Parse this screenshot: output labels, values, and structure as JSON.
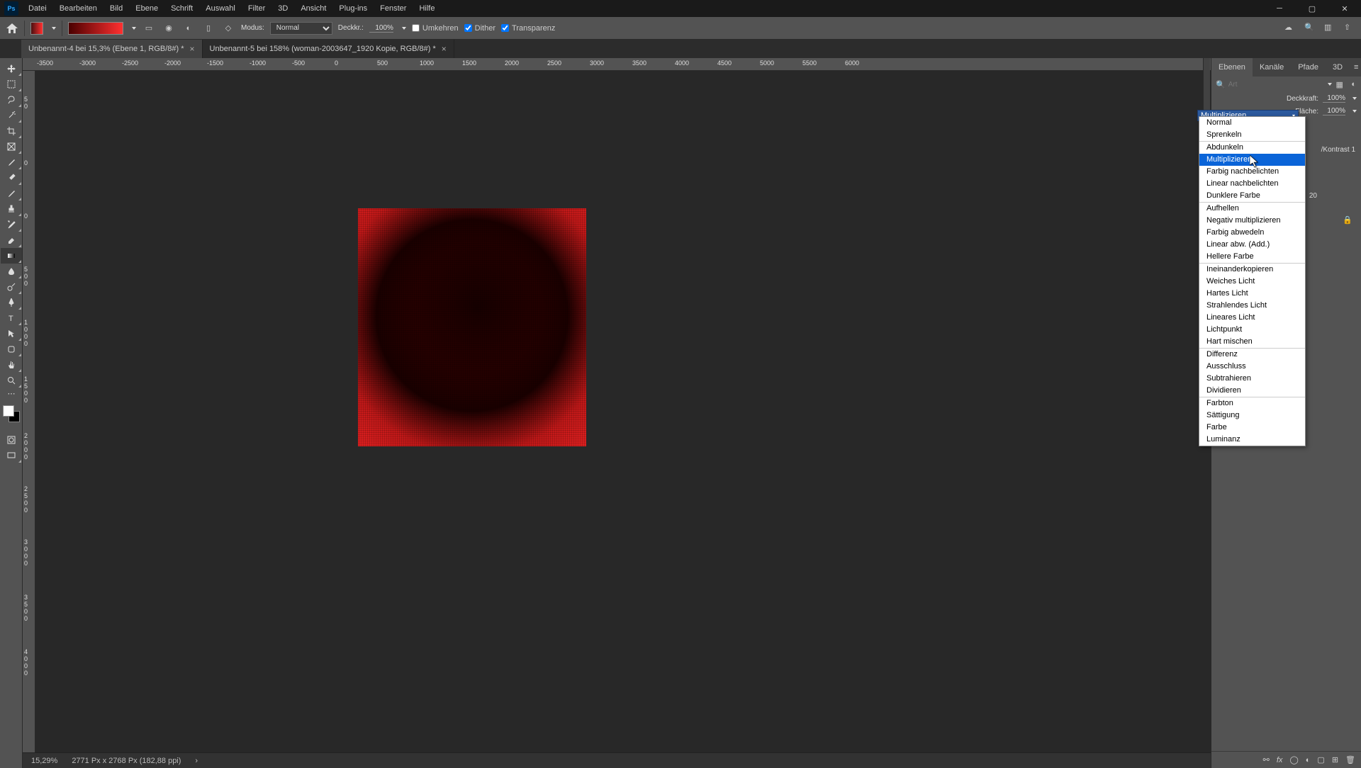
{
  "menu": [
    "Datei",
    "Bearbeiten",
    "Bild",
    "Ebene",
    "Schrift",
    "Auswahl",
    "Filter",
    "3D",
    "Ansicht",
    "Plug-ins",
    "Fenster",
    "Hilfe"
  ],
  "options": {
    "modus_label": "Modus:",
    "modus_value": "Normal",
    "deckkraft_label": "Deckkr.:",
    "deckkraft_value": "100%",
    "umkehren": "Umkehren",
    "dither": "Dither",
    "transparenz": "Transparenz"
  },
  "tabs": [
    "Unbenannt-4 bei 15,3% (Ebene 1, RGB/8#) *",
    "Unbenannt-5 bei 158% (woman-2003647_1920 Kopie, RGB/8#) *"
  ],
  "ruler_h": [
    "-3500",
    "-3000",
    "-2500",
    "-2000",
    "-1500",
    "-1000",
    "-500",
    "0",
    "500",
    "1000",
    "1500",
    "2000",
    "2500",
    "3000",
    "3500",
    "4000",
    "4500",
    "5000",
    "5500",
    "6000"
  ],
  "ruler_v": [
    "5\n0",
    "0",
    "5\n0\n0",
    "1\n0\n0",
    "0",
    "1\n5\n0",
    "0",
    "2\n0\n0",
    "2\n5\n0",
    "0",
    "3\n0\n0",
    "0",
    "3\n5\n0",
    "0",
    "4\n0\n0"
  ],
  "status": {
    "zoom": "15,29%",
    "info": "2771 Px x 2768 Px (182,88 ppi)"
  },
  "panel": {
    "tabs": [
      "Ebenen",
      "Kanäle",
      "Pfade",
      "3D"
    ],
    "filter_placeholder": "Art",
    "blend_selected": "Multiplizieren",
    "deckkraft_label": "Deckkraft:",
    "deckkraft_value": "100%",
    "flaeche_label": "Fläche:",
    "flaeche_value": "100%",
    "kontrast_label": "/Kontrast 1",
    "hidden_value": "20"
  },
  "blend_groups": [
    [
      "Normal",
      "Sprenkeln"
    ],
    [
      "Abdunkeln",
      "Multiplizieren",
      "Farbig nachbelichten",
      "Linear nachbelichten",
      "Dunklere Farbe"
    ],
    [
      "Aufhellen",
      "Negativ multiplizieren",
      "Farbig abwedeln",
      "Linear abw. (Add.)",
      "Hellere Farbe"
    ],
    [
      "Ineinanderkopieren",
      "Weiches Licht",
      "Hartes Licht",
      "Strahlendes Licht",
      "Lineares Licht",
      "Lichtpunkt",
      "Hart mischen"
    ],
    [
      "Differenz",
      "Ausschluss",
      "Subtrahieren",
      "Dividieren"
    ],
    [
      "Farbton",
      "Sättigung",
      "Farbe",
      "Luminanz"
    ]
  ],
  "blend_highlight": "Multiplizieren"
}
